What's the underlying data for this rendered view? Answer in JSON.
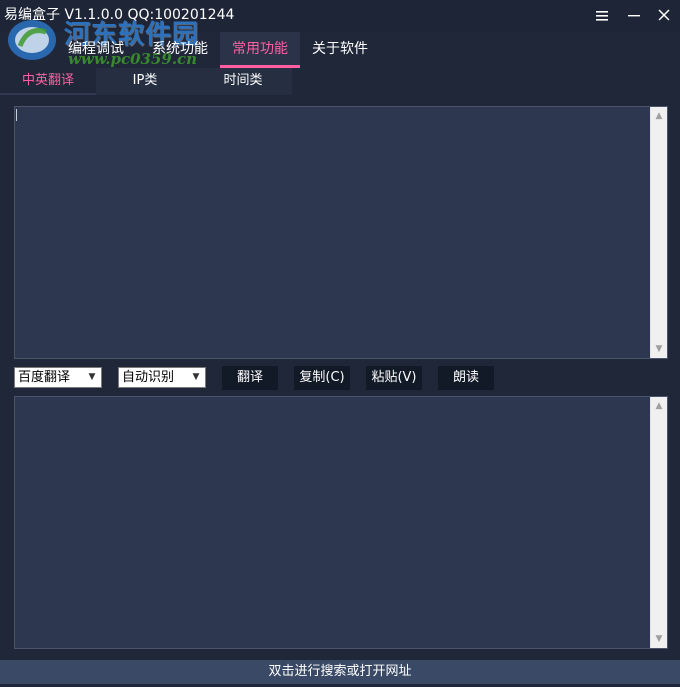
{
  "window": {
    "title": "易编盒子 V1.1.0.0 QQ:100201244",
    "min_icon": "minimize-icon",
    "menu_icon": "hamburger-menu-icon",
    "close_icon": "close-icon"
  },
  "watermark": {
    "site_name": "河东软件园",
    "url": "www.pc0359.cn"
  },
  "menu": {
    "items": [
      {
        "label": "编程调试",
        "active": false
      },
      {
        "label": "系统功能",
        "active": false
      },
      {
        "label": "常用功能",
        "active": true
      },
      {
        "label": "关于软件",
        "active": false
      }
    ]
  },
  "subtabs": {
    "items": [
      {
        "label": "中英翻译",
        "active": true
      },
      {
        "label": "IP类",
        "active": false
      },
      {
        "label": "时间类",
        "active": false
      }
    ]
  },
  "input_box": {
    "value": ""
  },
  "output_box": {
    "value": ""
  },
  "controls": {
    "engine_select": "百度翻译",
    "language_select": "自动识别",
    "translate_label": "翻译",
    "copy_label": "复制(C)",
    "paste_label": "粘贴(V)",
    "read_label": "朗读"
  },
  "status": {
    "text": "双击进行搜索或打开网址"
  },
  "colors": {
    "background": "#1f2738",
    "textbox": "#2d3850",
    "accent": "#ff5fa2",
    "statusbar": "#3a4a66"
  }
}
